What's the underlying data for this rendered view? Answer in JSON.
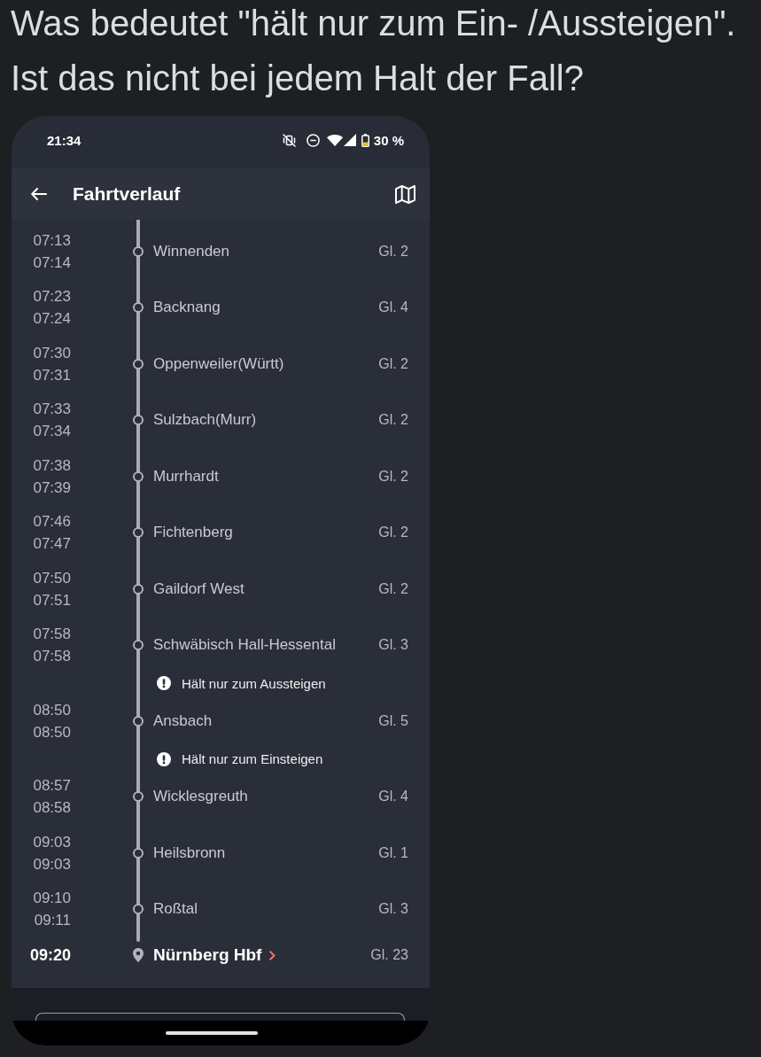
{
  "message": {
    "text": "Was bedeutet \"hält nur zum Ein- /Aussteigen\". Ist das nicht bei jedem Halt der Fall?"
  },
  "phone": {
    "status_bar": {
      "time": "21:34",
      "battery": "30 %"
    },
    "app_bar": {
      "title": "Fahrtverlauf"
    },
    "stops": [
      {
        "kind": "stop",
        "arrival": "07:13",
        "departure": "07:14",
        "name": "Winnenden",
        "platform": "Gl. 2"
      },
      {
        "kind": "stop",
        "arrival": "07:23",
        "departure": "07:24",
        "name": "Backnang",
        "platform": "Gl. 4"
      },
      {
        "kind": "stop",
        "arrival": "07:30",
        "departure": "07:31",
        "name": "Oppenweiler(Württ)",
        "platform": "Gl. 2"
      },
      {
        "kind": "stop",
        "arrival": "07:33",
        "departure": "07:34",
        "name": "Sulzbach(Murr)",
        "platform": "Gl. 2"
      },
      {
        "kind": "stop",
        "arrival": "07:38",
        "departure": "07:39",
        "name": "Murrhardt",
        "platform": "Gl. 2"
      },
      {
        "kind": "stop",
        "arrival": "07:46",
        "departure": "07:47",
        "name": "Fichtenberg",
        "platform": "Gl. 2"
      },
      {
        "kind": "stop",
        "arrival": "07:50",
        "departure": "07:51",
        "name": "Gaildorf West",
        "platform": "Gl. 2"
      },
      {
        "kind": "stop",
        "arrival": "07:58",
        "departure": "07:58",
        "name": "Schwäbisch Hall-Hessental",
        "platform": "Gl. 3",
        "note": "Hält nur zum Aussteigen"
      },
      {
        "kind": "stop",
        "arrival": "08:50",
        "departure": "08:50",
        "name": "Ansbach",
        "platform": "Gl. 5",
        "note": "Hält nur zum Einsteigen"
      },
      {
        "kind": "stop",
        "arrival": "08:57",
        "departure": "08:58",
        "name": "Wicklesgreuth",
        "platform": "Gl. 4"
      },
      {
        "kind": "stop",
        "arrival": "09:03",
        "departure": "09:03",
        "name": "Heilsbronn",
        "platform": "Gl. 1"
      },
      {
        "kind": "stop",
        "arrival": "09:10",
        "departure": "09:11",
        "name": "Roßtal",
        "platform": "Gl. 3"
      },
      {
        "kind": "destination",
        "arrival": "09:20",
        "name": "Nürnberg Hbf",
        "platform": "Gl. 23"
      }
    ]
  }
}
